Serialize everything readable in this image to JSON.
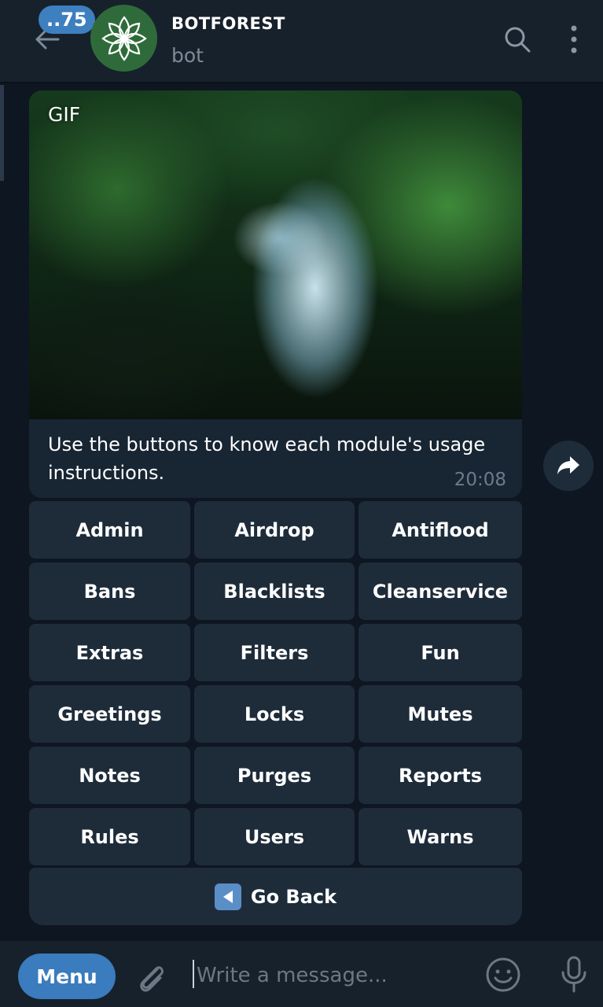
{
  "header": {
    "unread_count": "..75",
    "title": "BOTFOREST",
    "subtitle": "bot",
    "icons": {
      "back": "arrow-left-icon",
      "search": "search-icon",
      "more": "kebab-menu-icon",
      "avatar": "flower-logo"
    }
  },
  "message": {
    "media_label": "GIF",
    "caption": "Use the buttons to know each module's usage instructions.",
    "time": "20:08",
    "share_icon": "share-arrow-icon"
  },
  "keyboard": {
    "rows": [
      [
        "Admin",
        "Airdrop",
        "Antiflood"
      ],
      [
        "Bans",
        "Blacklists",
        "Cleanservice"
      ],
      [
        "Extras",
        "Filters",
        "Fun"
      ],
      [
        "Greetings",
        "Locks",
        "Mutes"
      ],
      [
        "Notes",
        "Purges",
        "Reports"
      ],
      [
        "Rules",
        "Users",
        "Warns"
      ]
    ],
    "go_back": "Go Back",
    "go_back_icon": "left-triangle-icon"
  },
  "composer": {
    "menu_label": "Menu",
    "placeholder": "Write a message...",
    "icons": {
      "attach": "paperclip-icon",
      "emoji": "smiley-icon",
      "mic": "microphone-icon"
    }
  },
  "colors": {
    "background": "#0e1621",
    "header": "#17212b",
    "bubble": "#182533",
    "button": "#1e2c3a",
    "accent": "#3a7cbd"
  }
}
